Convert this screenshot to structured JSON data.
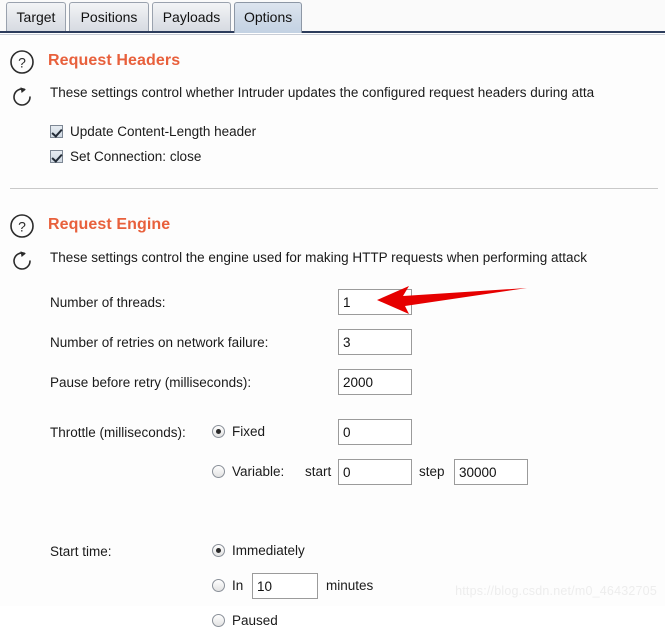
{
  "tabs": [
    {
      "label": "Target",
      "active": false
    },
    {
      "label": "Positions",
      "active": false
    },
    {
      "label": "Payloads",
      "active": false
    },
    {
      "label": "Options",
      "active": true
    }
  ],
  "sections": {
    "request_headers": {
      "title": "Request Headers",
      "help_icon": "question-circle-icon",
      "refresh_icon": "refresh-icon",
      "description": "These settings control whether Intruder updates the configured request headers during atta",
      "checkboxes": [
        {
          "label": "Update Content-Length header",
          "checked": true
        },
        {
          "label": "Set Connection: close",
          "checked": true
        }
      ]
    },
    "request_engine": {
      "title": "Request Engine",
      "help_icon": "question-circle-icon",
      "refresh_icon": "refresh-icon",
      "description": "These settings control the engine used for making HTTP requests when performing attack",
      "fields": {
        "threads": {
          "label": "Number of threads:",
          "value": "1"
        },
        "retries": {
          "label": "Number of retries on network failure:",
          "value": "3"
        },
        "pause": {
          "label": "Pause before retry (milliseconds):",
          "value": "2000"
        }
      },
      "throttle": {
        "label": "Throttle (milliseconds):",
        "fixed": {
          "label": "Fixed",
          "selected": true,
          "value": "0"
        },
        "variable": {
          "label": "Variable:",
          "selected": false,
          "start_label": "start",
          "start_value": "0",
          "step_label": "step",
          "step_value": "30000"
        }
      },
      "start_time": {
        "label": "Start time:",
        "options": [
          {
            "label": "Immediately",
            "selected": true
          },
          {
            "label": "In",
            "selected": false,
            "value": "10",
            "suffix": "minutes"
          },
          {
            "label": "Paused",
            "selected": false
          }
        ]
      }
    }
  },
  "annotation": {
    "arrow_color": "#e60000",
    "arrow_name": "red-pointer-arrow"
  },
  "watermark": "https://blog.csdn.net/m0_46432705",
  "colors": {
    "heading": "#e8603c",
    "tab_active_bg": "#c9d7e6",
    "underline": "#2c3c5c"
  }
}
